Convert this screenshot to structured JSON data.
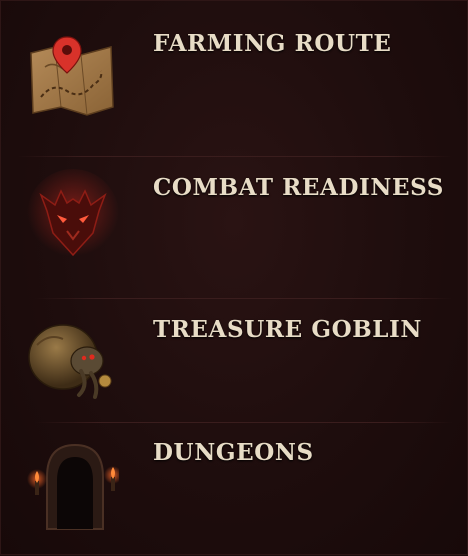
{
  "menu": {
    "items": [
      {
        "title": "FARMING ROUTE",
        "icon": "treasure-map-icon"
      },
      {
        "title": "COMBAT READINESS",
        "icon": "demon-skull-icon"
      },
      {
        "title": "TREASURE GOBLIN",
        "icon": "treasure-goblin-icon"
      },
      {
        "title": "DUNGEONS",
        "icon": "dungeon-gate-icon"
      }
    ]
  },
  "colors": {
    "background": "#1e0d0d",
    "title_text": "#e8dcc6",
    "map_pin": "#d8322a",
    "demon_glow": "#c0281e"
  }
}
